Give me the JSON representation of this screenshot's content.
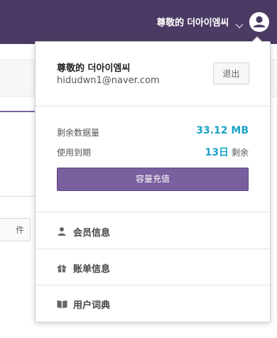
{
  "header": {
    "user_name": "尊敬的 더아이엠씨",
    "icons": {
      "dropdown": "chevron-down-icon",
      "avatar": "user-avatar-icon"
    },
    "color": "#4b3a63"
  },
  "background": {
    "button_label": "件"
  },
  "dropdown": {
    "profile": {
      "name": "尊敬的 더아이엠씨",
      "email": "hidudwn1@naver.com",
      "logout_label": "退出"
    },
    "stats": {
      "remaining_label": "剩余数据量",
      "remaining_value": "33.12 MB",
      "expiry_label": "使用到期",
      "expiry_value": "13日",
      "expiry_suffix": "剩余",
      "recharge_label": "容量充值",
      "accent_color": "#1aa3c5",
      "button_color": "#7a5f9f"
    },
    "menu": [
      {
        "label": "会员信息",
        "icon": "user-icon"
      },
      {
        "label": "账单信息",
        "icon": "gift-icon"
      },
      {
        "label": "用户词典",
        "icon": "book-icon"
      }
    ]
  }
}
